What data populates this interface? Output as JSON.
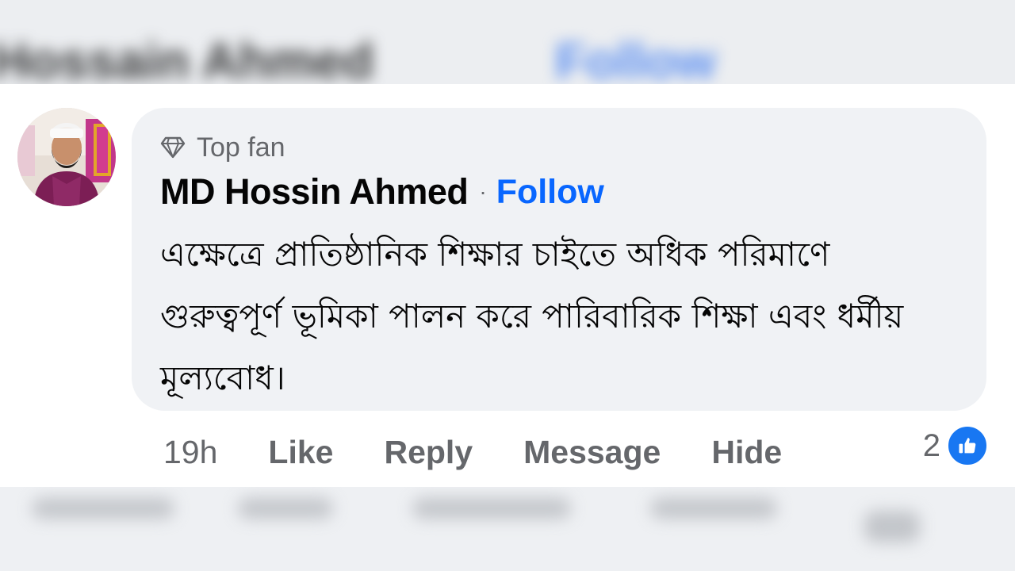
{
  "header_blurred": {
    "name": "Hossain Ahmed",
    "follow": "Follow"
  },
  "comment": {
    "badge_icon": "diamond-icon",
    "badge_label": "Top fan",
    "author": "MD Hossin Ahmed",
    "separator": "·",
    "follow_label": "Follow",
    "text": "এক্ষেত্রে প্রাতিষ্ঠানিক শিক্ষার চাইতে অধিক পরিমাণে গুরুত্বপূর্ণ ভূমিকা পালন করে পারিবারিক শিক্ষা এবং ধর্মীয় মূল্যবোধ।",
    "time": "19h",
    "actions": {
      "like": "Like",
      "reply": "Reply",
      "message": "Message",
      "hide": "Hide"
    },
    "reaction_count": "2",
    "reaction_icon": "thumbs-up-icon",
    "colors": {
      "accent": "#0866ff",
      "secondary_text": "#65676b",
      "bubble_bg": "#f0f2f5",
      "like_badge": "#1877f2"
    }
  }
}
